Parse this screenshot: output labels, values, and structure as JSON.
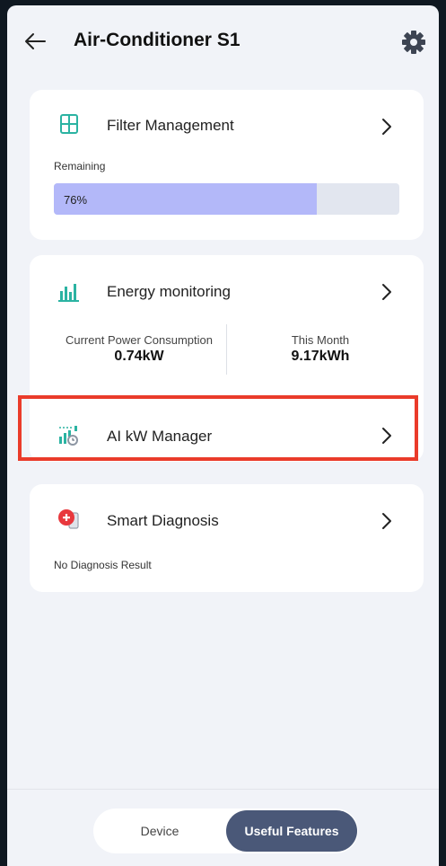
{
  "header": {
    "title": "Air-Conditioner S1",
    "back_icon": "back-arrow-icon",
    "settings_icon": "gear-icon"
  },
  "filter": {
    "title": "Filter Management",
    "remaining_label": "Remaining",
    "remaining_text": "76%",
    "remaining_fraction": 0.76,
    "icon": "filter-grid-icon"
  },
  "energy": {
    "title": "Energy monitoring",
    "current_label": "Current Power Consumption",
    "current_value": "0.74kW",
    "month_label": "This Month",
    "month_value": "9.17kWh",
    "icon": "bar-chart-icon"
  },
  "ai_kw": {
    "title": "AI kW Manager",
    "icon": "ai-kw-manager-icon"
  },
  "diagnosis": {
    "title": "Smart Diagnosis",
    "result": "No Diagnosis Result",
    "icon": "smart-diagnosis-icon"
  },
  "bottom_tabs": {
    "device": "Device",
    "useful": "Useful Features",
    "selected": "Useful Features"
  },
  "colors": {
    "accent_teal": "#2bb3a2",
    "progress_fill": "#b3b8f9",
    "highlight_border": "#ea3b2a",
    "selected_tab": "#4a5878"
  }
}
